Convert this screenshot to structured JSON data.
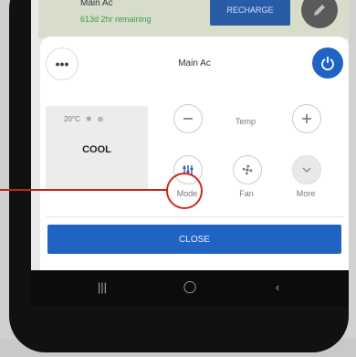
{
  "header": {
    "title": "Main Ac",
    "subtitle": "613d 2hr remaining",
    "recharge_label": "RECHARGE"
  },
  "sheet": {
    "title": "Main Ac",
    "current_temp": "20°C",
    "mode_name": "COOL",
    "temp_label": "Temp",
    "mode_label": "Mode",
    "fan_label": "Fan",
    "more_label": "More",
    "close_label": "CLOSE"
  },
  "icons": {
    "more_options": "ellipsis-icon",
    "power": "power-icon",
    "edit": "pencil-icon",
    "snow": "snowflake-icon",
    "fan_small": "fan-icon",
    "minus": "minus-icon",
    "plus": "plus-icon",
    "mode": "sliders-icon",
    "fan": "fan-icon",
    "more": "chevron-down-icon"
  },
  "colors": {
    "accent": "#1f64c2",
    "highlight": "#d0281e",
    "remaining": "#3b9d47"
  }
}
